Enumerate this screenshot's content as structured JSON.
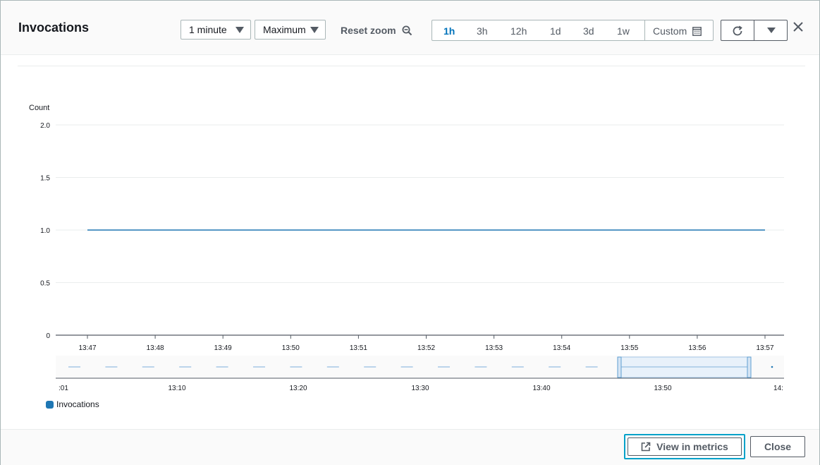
{
  "header": {
    "title": "Invocations",
    "period": "1 minute",
    "statistic": "Maximum",
    "reset_zoom": "Reset zoom",
    "ranges": [
      {
        "label": "1h",
        "active": true
      },
      {
        "label": "3h",
        "active": false
      },
      {
        "label": "12h",
        "active": false
      },
      {
        "label": "1d",
        "active": false
      },
      {
        "label": "3d",
        "active": false
      },
      {
        "label": "1w",
        "active": false
      }
    ],
    "custom": "Custom"
  },
  "chart_data": {
    "type": "line",
    "ylabel": "Count",
    "ylim": [
      0,
      2
    ],
    "y_ticks": [
      "0",
      "0.5",
      "1.0",
      "1.5",
      "2.0"
    ],
    "x_ticks": [
      "13:47",
      "13:48",
      "13:49",
      "13:50",
      "13:51",
      "13:52",
      "13:53",
      "13:54",
      "13:55",
      "13:56",
      "13:57"
    ],
    "series": [
      {
        "name": "Invocations",
        "color": "#1f77b4",
        "x": [
          "13:47",
          "13:48",
          "13:49",
          "13:50",
          "13:51",
          "13:52",
          "13:53",
          "13:54",
          "13:55",
          "13:56",
          "13:57"
        ],
        "values": [
          1,
          1,
          1,
          1,
          1,
          1,
          1,
          1,
          1,
          1,
          1
        ]
      }
    ],
    "grid": true,
    "legend": "bottom-left",
    "overview_ticks": [
      ":01",
      "13:10",
      "13:20",
      "13:30",
      "13:40",
      "13:50",
      "14:"
    ]
  },
  "footer": {
    "view_in_metrics": "View in metrics",
    "close": "Close"
  },
  "colors": {
    "accent": "#0073bb",
    "focus": "#00a1c9",
    "series": "#1f77b4"
  }
}
